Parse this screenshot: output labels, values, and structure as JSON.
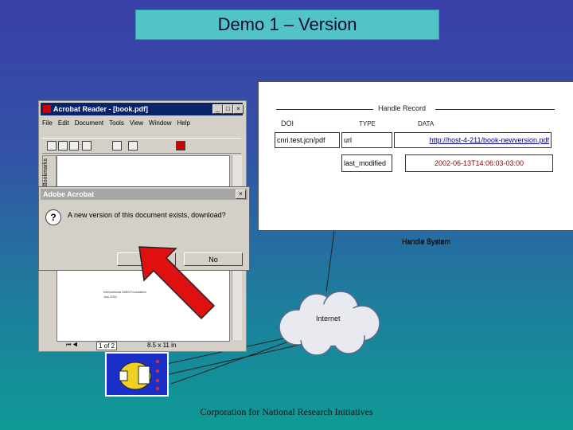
{
  "slide": {
    "title": "Demo 1 – Version",
    "footer": "Corporation for National Research Initiatives"
  },
  "handle_record": {
    "heading": "Handle Record",
    "col_doi": "DOI",
    "col_type": "TYPE",
    "col_data": "DATA",
    "doi_value": "cnri.test.jcn/pdf",
    "rows": [
      {
        "type": "url",
        "data": "http://host-4-211/book-newversion.pdf"
      },
      {
        "type": "last_modified",
        "data": "2002-06-13T14:06:03-03:00"
      }
    ],
    "system_label": "Handle System"
  },
  "acrobat": {
    "title": "Acrobat Reader - [book.pdf]",
    "menu": [
      "File",
      "Edit",
      "Document",
      "Tools",
      "View",
      "Window",
      "Help"
    ],
    "side_tab": "Bookmarks",
    "page_text": [
      "International DMM Foundation",
      "July 2001"
    ],
    "status_page": "1 of 2",
    "status_size": "8.5 x 11 in"
  },
  "dialog": {
    "title": "Adobe Acrobat",
    "message": "A new version of this document exists, download?",
    "yes": "Yes",
    "no": "No"
  },
  "cloud": {
    "label": "Internet"
  },
  "icons": {
    "question": "question-icon",
    "plug": "plug-icon"
  }
}
